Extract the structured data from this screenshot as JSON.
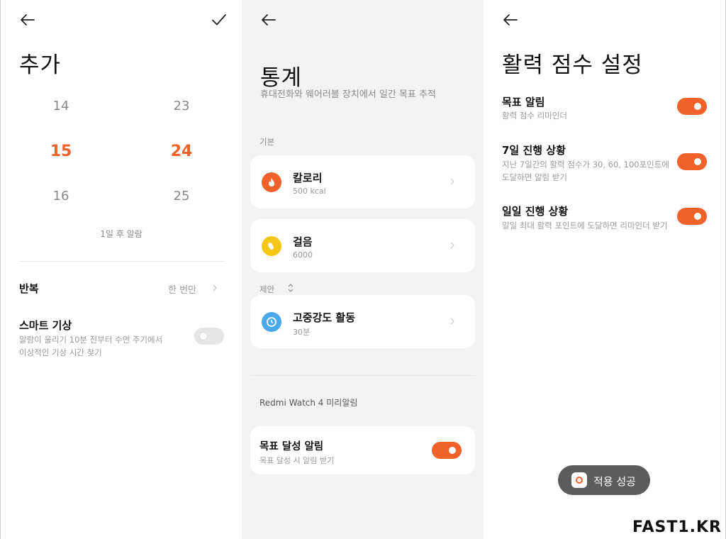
{
  "alarm_panel": {
    "title": "추가",
    "picker": {
      "hours": [
        "14",
        "15",
        "16"
      ],
      "minutes": [
        "23",
        "24",
        "25"
      ],
      "selected_hour": "15",
      "selected_minute": "24"
    },
    "summary": "1일 후 알람",
    "repeat": {
      "label": "반복",
      "value": "한 번만"
    },
    "smart_wake": {
      "label": "스마트 기상",
      "desc_line1": "알람이 울리기 10분 전부터 수면 주기에서",
      "desc_line2": "이상적인 기상 시간 찾기",
      "enabled": false
    }
  },
  "stats_panel": {
    "title": "통계",
    "subtitle": "휴대전화와 웨어러블 장치에서 일간 목표 추적",
    "section_basic": "기본",
    "cards": [
      {
        "title": "칼로리",
        "sub": "500 kcal",
        "icon": "flame-icon",
        "color": "#f0622a"
      },
      {
        "title": "걸음",
        "sub": "6000",
        "icon": "footprint-icon",
        "color": "#f5c518"
      },
      {
        "title": "고중강도 활동",
        "sub": "30분",
        "icon": "clock-icon",
        "color": "#4aa8ef"
      }
    ],
    "section_suggest": "제안",
    "device_label": "Redmi Watch 4 미리알림",
    "goal_alert": {
      "title": "목표 달성 알림",
      "sub": "목표 달성 시 알림 받기",
      "enabled": true
    }
  },
  "activity_panel": {
    "title": "활력 점수 설정",
    "items": [
      {
        "title": "목표 알림",
        "desc1": "활력 점수 리마인더",
        "desc2": "",
        "enabled": true
      },
      {
        "title": "7일 진행 상황",
        "desc1": "지난 7일간의 활력 점수가 30, 60, 100포인트에",
        "desc2": "도달하면 알림 받기",
        "enabled": true
      },
      {
        "title": "일일 진행 상황",
        "desc1": "일일 최대 활력 포인트에 도달하면 리마인더 받기",
        "desc2": "",
        "enabled": true
      }
    ],
    "toast": "적용 성공"
  },
  "watermark": "FAST1.KR",
  "colors": {
    "accent": "#f0622a",
    "toggle_off": "#e6e6e6",
    "panel_gray": "#f3f3f3"
  }
}
